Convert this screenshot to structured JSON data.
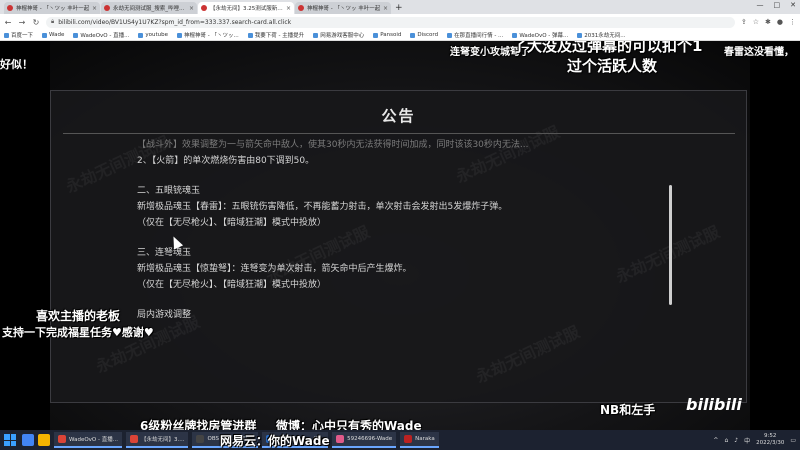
{
  "browser": {
    "tabs": [
      {
        "title": "神棍神哥 - 「丶ツッ 丰叶一起",
        "active": false
      },
      {
        "title": "永劫无间测试服_搜索_哔哩哔哩",
        "active": false
      },
      {
        "title": "【永劫无间】3.25测试服新增物...",
        "active": true
      },
      {
        "title": "神棍神哥 - 「丶ツッ 丰叶一起",
        "active": false
      }
    ],
    "new_tab": "+",
    "url": "bilibili.com/video/BV1US4y1U7KZ?spm_id_from=333.337.search-card.all.click",
    "window_controls": {
      "minimize": "—",
      "maximize": "□",
      "close": "✕"
    }
  },
  "bookmarks": [
    "百度一下",
    "Wade",
    "WadeOvO - 直播...",
    "youtube",
    "神棍神哥 - 「丶ツッ...",
    "我要下荷 - 主播提升",
    "网易游戏客服中心",
    "Pansoid",
    "Discord",
    "在那直播间行情 - ...",
    "WadeOvO - 弹幕...",
    "2031永劫无间..."
  ],
  "announcement": {
    "title": "公告",
    "cut_line": "【战斗外】效果调整为一与箭矢命中敌人，使其30秒内无法获得时间加成，同时该该30秒内无法...",
    "lines": [
      "2、【火箭】的单次燃烧伤害由80下调到50。"
    ],
    "sections": [
      {
        "heading": "二、五眼铳魂玉",
        "body": "新增极品魂玉【春雷】：五眼铳伤害降低，不再能蓄力射击，单次射击会发射出5发爆炸子弹。",
        "note": "（仅在【无尽枪火】、【暗域狂潮】模式中投放）"
      },
      {
        "heading": "三、连弩魂玉",
        "body": "新增极品魂玉【惊蛰弩】：连弩变为单次射击，箭矢命中后产生爆炸。",
        "note": "（仅在【无尽枪火】、【暗域狂潮】模式中投放）"
      }
    ],
    "footer": "局内游戏调整",
    "watermark": "永劫无间测试服"
  },
  "overlays": {
    "top_left": "好似！",
    "top_center_1": "连弩变小攻城弩了",
    "top_center_big_1": "了大没及过弹幕的可以扣个1",
    "top_center_big_2": "过个活跃人数",
    "top_right": "春雷这没看懂，",
    "left_mid_1": "喜欢主播的老板",
    "left_mid_2": "支持一下完成福星任务♥感谢♥",
    "bottom_1": "6级粉丝牌找房管进群",
    "bottom_2": "微博：心中只有秀的Wade",
    "bottom_3": "网易云：你的Wade",
    "bottom_right": "NB和左手",
    "bili_logo": "bilibili"
  },
  "taskbar": {
    "items": [
      "WadeOvO - 直播...",
      "【永劫无间】3....",
      "OBS 26.1.1 (64...",
      "Studio One - 播...",
      "59246696-Wade",
      "Naraka"
    ],
    "time": "9:52",
    "date": "2022/3/30",
    "lang": "中"
  }
}
